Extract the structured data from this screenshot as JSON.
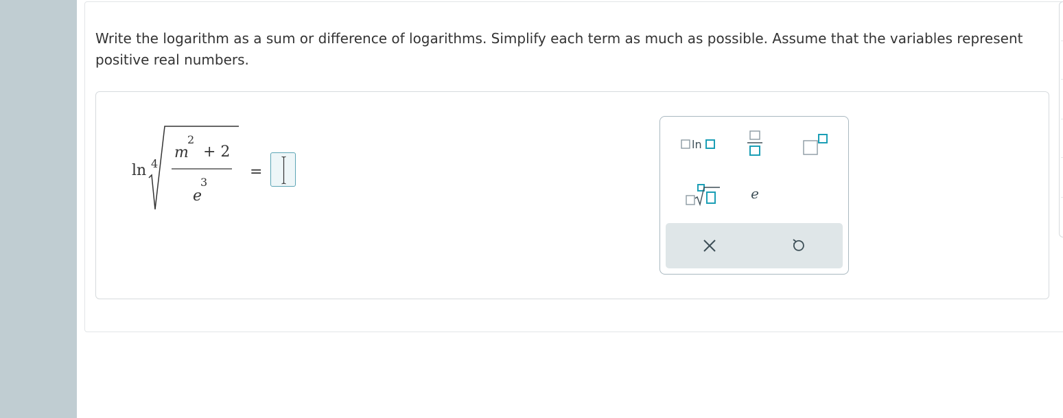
{
  "question": {
    "instructions": "Write the logarithm as a sum or difference of logarithms. Simplify each term as much as possible. Assume that the variables represent positive real numbers."
  },
  "expression": {
    "ln": "ln",
    "root_index": "4",
    "numerator_var": "m",
    "numerator_exp": "2",
    "numerator_plus": "+ 2",
    "denominator_base": "e",
    "denominator_exp": "3",
    "equals": "="
  },
  "answer": {
    "value": ""
  },
  "palette": {
    "buttons": [
      {
        "name": "log-template",
        "label": "ln",
        "icon": "box-ln-box"
      },
      {
        "name": "fraction-template",
        "icon": "box-over-box"
      },
      {
        "name": "superscript-template",
        "icon": "box-with-superscript-box"
      },
      {
        "name": "nth-root-template",
        "icon": "box-index-root-box"
      },
      {
        "name": "e-constant",
        "label": "e"
      }
    ],
    "actions": [
      {
        "name": "clear",
        "icon": "close-icon"
      },
      {
        "name": "undo",
        "icon": "undo-icon"
      }
    ],
    "accent_color": "#1a9eb5"
  }
}
